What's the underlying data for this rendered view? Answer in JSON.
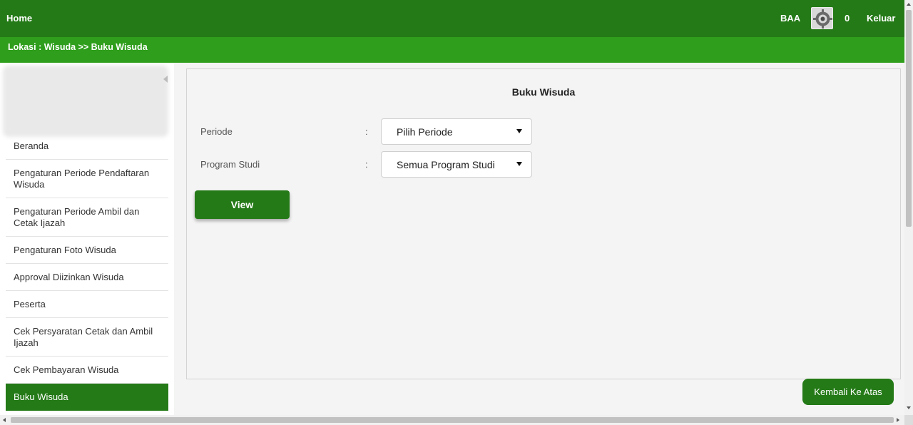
{
  "topbar": {
    "home_label": "Home",
    "user_label": "BAA",
    "notification_count": "0",
    "logout_label": "Keluar",
    "avatar_icon": "gear-avatar-icon"
  },
  "breadcrumb": {
    "text": "Lokasi : Wisuda >> Buku Wisuda"
  },
  "sidebar": {
    "items": [
      {
        "label": "Beranda",
        "active": false
      },
      {
        "label": "Pengaturan Periode Pendaftaran Wisuda",
        "active": false
      },
      {
        "label": "Pengaturan Periode Ambil dan Cetak Ijazah",
        "active": false
      },
      {
        "label": "Pengaturan Foto Wisuda",
        "active": false
      },
      {
        "label": "Approval Diizinkan Wisuda",
        "active": false
      },
      {
        "label": "Peserta",
        "active": false
      },
      {
        "label": "Cek Persyaratan Cetak dan Ambil Ijazah",
        "active": false
      },
      {
        "label": "Cek Pembayaran Wisuda",
        "active": false
      },
      {
        "label": "Buku Wisuda",
        "active": true
      }
    ]
  },
  "main": {
    "title": "Buku Wisuda",
    "fields": {
      "periode": {
        "label": "Periode",
        "colon": ":",
        "value": "Pilih Periode"
      },
      "program_studi": {
        "label": "Program Studi",
        "colon": ":",
        "value": "Semua Program Studi"
      }
    },
    "view_button": "View"
  },
  "back_to_top_button": "Kembali Ke Atas",
  "colors": {
    "header_green": "#247a17",
    "breadcrumb_green": "#2f9e1c",
    "background": "#f4f4f4"
  }
}
